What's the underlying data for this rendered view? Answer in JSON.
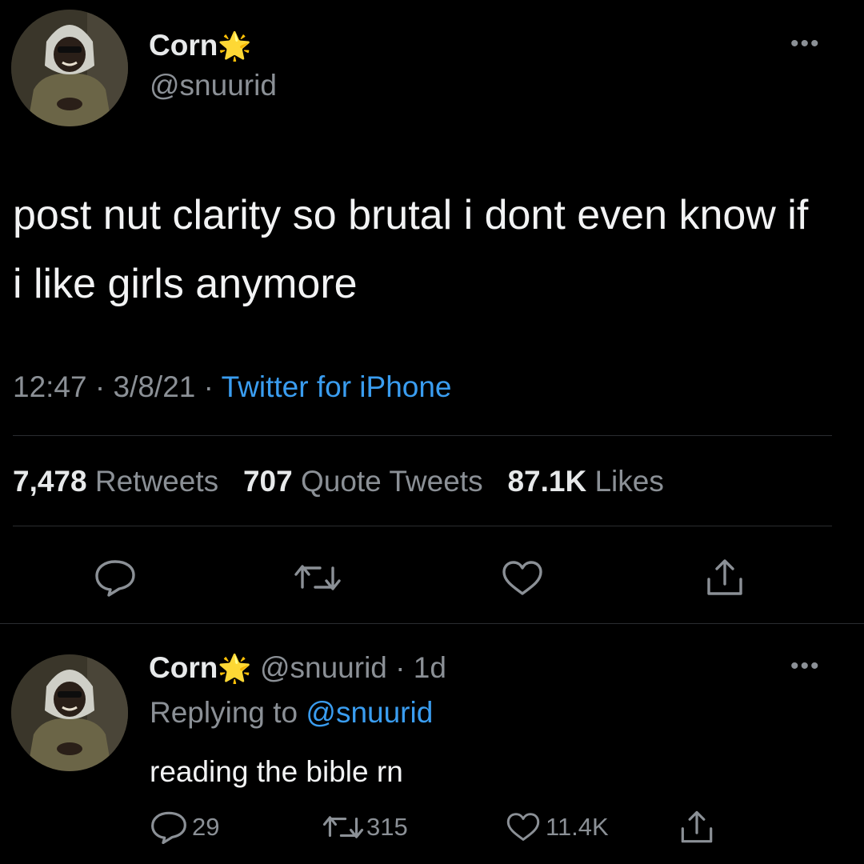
{
  "colors": {
    "background": "#000000",
    "text": "#e7e9ea",
    "muted": "#8b9096",
    "link": "#3a9df0",
    "divider": "#2a2d30"
  },
  "main_tweet": {
    "display_name": "Corn",
    "name_emoji": "🌟",
    "handle": "@snuurid",
    "text": "post nut clarity so brutal i dont even know if i like girls anymore",
    "time": "12:47",
    "date": "3/8/21",
    "source": "Twitter for iPhone",
    "stats": {
      "retweets_count": "7,478",
      "retweets_label": "Retweets",
      "quotes_count": "707",
      "quotes_label": "Quote Tweets",
      "likes_count": "87.1K",
      "likes_label": "Likes"
    },
    "more_label": "•••"
  },
  "reply_tweet": {
    "display_name": "Corn",
    "name_emoji": "🌟",
    "handle_time": "@snuurid · 1d",
    "replying_prefix": "Replying to",
    "replying_handle": "@snuurid",
    "text": "reading the bible rn",
    "reply_count": "29",
    "retweet_count": "315",
    "like_count": "11.4K",
    "more_label": "•••"
  },
  "separator": "·",
  "icons": [
    "comment-icon",
    "retweet-icon",
    "heart-icon",
    "share-icon",
    "star-emoji",
    "more-icon"
  ]
}
